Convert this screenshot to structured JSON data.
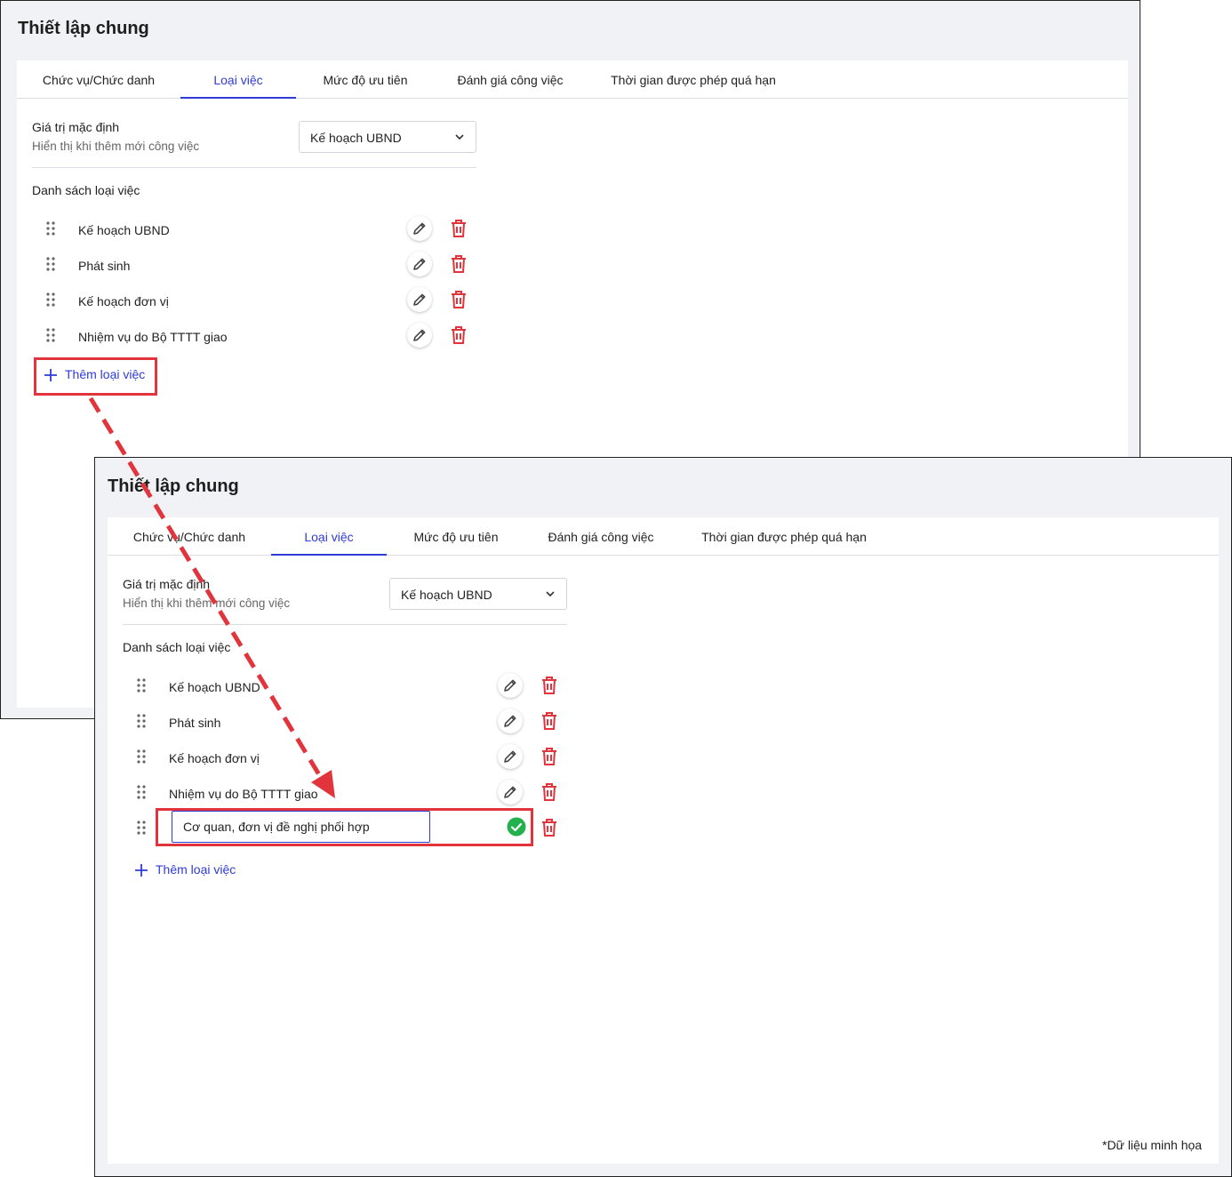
{
  "page": {
    "title": "Thiết lập chung",
    "footnote": "*Dữ liệu minh họa"
  },
  "tabs": [
    {
      "label": "Chức vụ/Chức danh"
    },
    {
      "label": "Loại việc"
    },
    {
      "label": "Mức độ ưu tiên"
    },
    {
      "label": "Đánh giá công việc"
    },
    {
      "label": "Thời gian được phép quá hạn"
    }
  ],
  "active_tab": "Loại việc",
  "default_value": {
    "label": "Giá trị mặc định",
    "hint": "Hiển thị khi thêm mới công việc",
    "selected": "Kế hoạch UBND"
  },
  "list": {
    "title": "Danh sách loại việc",
    "items": [
      {
        "label": "Kế hoạch UBND"
      },
      {
        "label": "Phát sinh"
      },
      {
        "label": "Kế hoạch đơn vị"
      },
      {
        "label": "Nhiệm vụ do Bộ TTTT giao"
      }
    ],
    "new_item_value": "Cơ quan, đơn vị đề nghị phối hợp"
  },
  "add_button_label": "Thêm loại việc",
  "colors": {
    "accent": "#2f3bd6",
    "delete": "#e2343c",
    "success": "#22b14c",
    "highlight": "#e2343c"
  },
  "icons": [
    "drag-handle-icon",
    "pencil-icon",
    "trash-icon",
    "plus-icon",
    "chevron-down-icon",
    "check-circle-icon"
  ]
}
